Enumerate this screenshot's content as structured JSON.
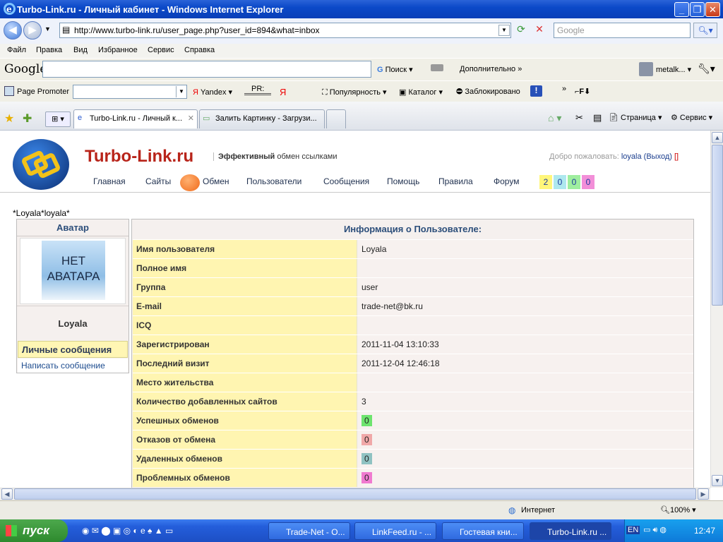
{
  "window": {
    "title": "Turbo-Link.ru - Личный кабинет - Windows Internet Explorer"
  },
  "address": {
    "url": "http://www.turbo-link.ru/user_page.php?user_id=894&what=inbox",
    "search_placeholder": "Google"
  },
  "menu": [
    "Файл",
    "Правка",
    "Вид",
    "Избранное",
    "Сервис",
    "Справка"
  ],
  "google_bar": {
    "logo": "Google",
    "search_label": "Поиск",
    "more_label": "Дополнительно",
    "user_label": "metalk..."
  },
  "promoter_bar": {
    "label": "Page Promoter",
    "yandex_label": "Yandex",
    "pr_label": "PR:",
    "ya_label": "Я",
    "popularity_label": "Популярность",
    "catalog_label": "Каталог",
    "blocked_label": "Заблокировано"
  },
  "tabs": [
    {
      "label": "Turbo-Link.ru - Личный к..."
    },
    {
      "label": "Залить Картинку - Загрузи..."
    }
  ],
  "command_bar": {
    "page_label": "Страница",
    "service_label": "Сервис"
  },
  "site": {
    "brand": "Turbo-Link.ru",
    "slogan_bold": "Эффективный",
    "slogan_rest": "обмен ссылками",
    "welcome_prefix": "Добро пожаловать:",
    "welcome_user": "loyala",
    "logout_label": "(Выход)",
    "nav": [
      "Главная",
      "Сайты",
      "Обмен",
      "Пользователи",
      "Сообщения",
      "Помощь",
      "Правила",
      "Форум"
    ],
    "counters": [
      {
        "value": "2",
        "color": "#fff67a"
      },
      {
        "value": "0",
        "color": "#aee8ee"
      },
      {
        "value": "0",
        "color": "#9fee9f"
      },
      {
        "value": "0",
        "color": "#f28fd8"
      }
    ],
    "crumb": "*Loyala*loyala*",
    "avatar_header": "Аватар",
    "avatar_text_1": "НЕТ",
    "avatar_text_2": "АВАТАРА",
    "username": "Loyala",
    "pm_label": "Личные сообщения",
    "pm_write": "Написать сообщение",
    "info_header": "Информация о Пользователе:",
    "info_rows": [
      {
        "label": "Имя пользователя",
        "value": "Loyala"
      },
      {
        "label": "Полное имя",
        "value": ""
      },
      {
        "label": "Группа",
        "value": "user"
      },
      {
        "label": "E-mail",
        "value": "trade-net@bk.ru"
      },
      {
        "label": "ICQ",
        "value": ""
      },
      {
        "label": "Зарегистрирован",
        "value": "2011-11-04 13:10:33"
      },
      {
        "label": "Последний визит",
        "value": "2011-12-04 12:46:18"
      },
      {
        "label": "Место жительства",
        "value": ""
      },
      {
        "label": "Количество добавленных сайтов",
        "value": "3"
      },
      {
        "label": "Успешных обменов",
        "value": "0",
        "badge": "#6ee46e"
      },
      {
        "label": "Отказов от обмена",
        "value": "0",
        "badge": "#f0a8a8"
      },
      {
        "label": "Удаленных обменов",
        "value": "0",
        "badge": "#8fc2c2"
      },
      {
        "label": "Проблемных обменов",
        "value": "0",
        "badge": "#f07ad0"
      }
    ]
  },
  "status": {
    "zone": "Интернет",
    "zoom": "100%"
  },
  "taskbar": {
    "start": "пуск",
    "tasks": [
      "Trade-Net - О...",
      "LinkFeed.ru - ...",
      "Гостевая кни...",
      "Turbo-Link.ru ..."
    ],
    "lang": "EN",
    "clock": "12:47"
  }
}
